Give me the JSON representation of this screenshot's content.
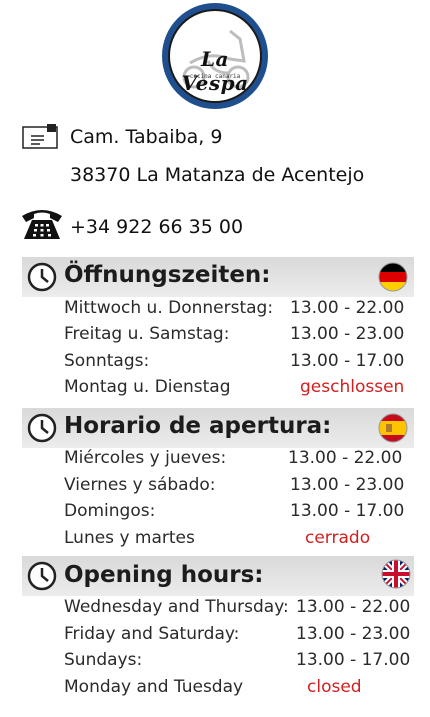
{
  "logo": {
    "name": "La Vespa",
    "subtitle": "cocina canaria"
  },
  "contact": {
    "address_line1": "Cam. Tabaiba, 9",
    "address_line2": "38370 La Matanza de Acentejo",
    "phone": "+34 922 66 35 00"
  },
  "sections": [
    {
      "title": "Öffnungszeiten:",
      "flag": "germany-flag",
      "rows": [
        {
          "label": "Mittwoch u. Donnerstag:",
          "value": "13.00 - 22.00"
        },
        {
          "label": "Freitag u. Samstag:",
          "value": "13.00 - 23.00"
        },
        {
          "label": "Sonntags:",
          "value": "13.00 - 17.00"
        },
        {
          "label": "Montag u. Dienstag",
          "value": "geschlossen"
        }
      ]
    },
    {
      "title": "Horario de apertura:",
      "flag": "spain-flag",
      "rows": [
        {
          "label": "Miércoles y jueves:",
          "value": "13.00 - 22.00"
        },
        {
          "label": "Viernes y sábado:",
          "value": "13.00 - 23.00"
        },
        {
          "label": "Domingos:",
          "value": "13.00 - 17.00"
        },
        {
          "label": "Lunes y martes",
          "value": "cerrado"
        }
      ]
    },
    {
      "title": "Opening hours:",
      "flag": "uk-flag",
      "rows": [
        {
          "label": "Wednesday and Thursday:",
          "value": "13.00 - 22.00"
        },
        {
          "label": "Friday and Saturday:",
          "value": "13.00 - 23.00"
        },
        {
          "label": "Sundays:",
          "value": "13.00 - 17.00"
        },
        {
          "label": "Monday and Tuesday",
          "value": "closed"
        }
      ]
    }
  ],
  "colors": {
    "closed": "#d01f1f",
    "logo_ring": "#1f4f8f",
    "header_bar": "#dedede"
  },
  "icons": [
    "envelope-icon",
    "telephone-icon",
    "clock-icon"
  ]
}
